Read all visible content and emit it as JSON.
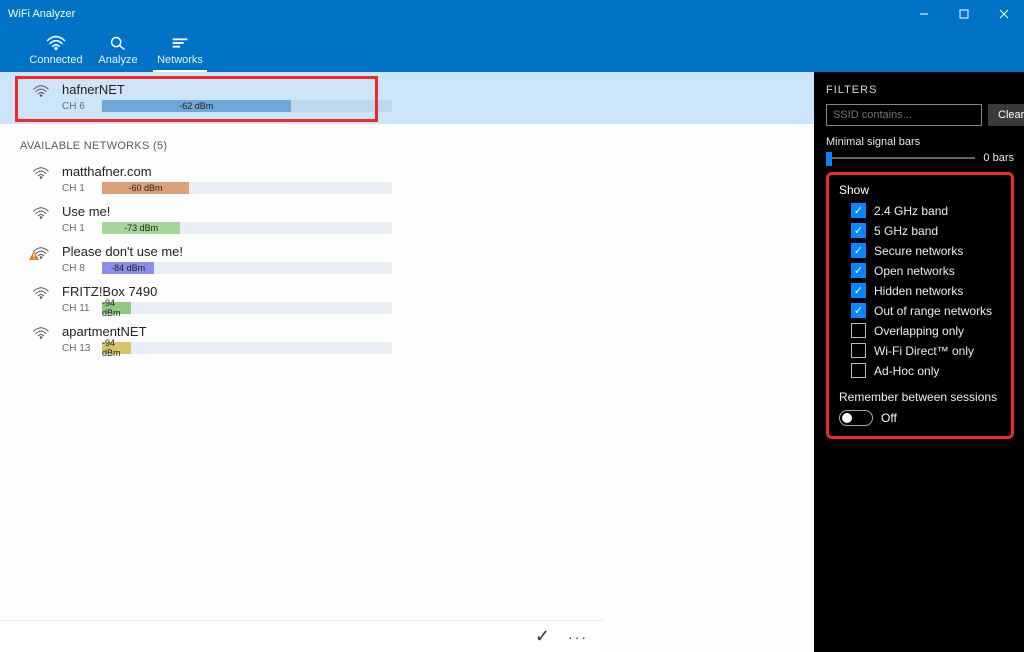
{
  "app_title": "WiFi Analyzer",
  "nav": {
    "connected": "Connected",
    "analyze": "Analyze",
    "networks": "Networks"
  },
  "connected_network": {
    "ssid": "hafnerNET",
    "channel": "CH 6",
    "signal_label": "-62 dBm",
    "bar_pct": 65,
    "bar_color": "#6ea7d9"
  },
  "available_header": "AVAILABLE NETWORKS (5)",
  "networks": [
    {
      "ssid": "matthafner.com",
      "channel": "CH 1",
      "signal_label": "-60 dBm",
      "bar_pct": 30,
      "bar_color": "#d9a27a",
      "warn": false
    },
    {
      "ssid": "Use me!",
      "channel": "CH 1",
      "signal_label": "-73 dBm",
      "bar_pct": 27,
      "bar_color": "#a6d69a",
      "warn": false
    },
    {
      "ssid": "Please don't use me!",
      "channel": "CH 8",
      "signal_label": "-84 dBm",
      "bar_pct": 18,
      "bar_color": "#8b8fea",
      "warn": true
    },
    {
      "ssid": "FRITZ!Box 7490",
      "channel": "CH 11",
      "signal_label": "-94 dBm",
      "bar_pct": 10,
      "bar_color": "#8fc97f",
      "warn": false
    },
    {
      "ssid": "apartmentNET",
      "channel": "CH 13",
      "signal_label": "-94 dBm",
      "bar_pct": 10,
      "bar_color": "#d6c46a",
      "warn": false
    }
  ],
  "filters": {
    "title": "FILTERS",
    "ssid_placeholder": "SSID contains...",
    "clear": "Clear",
    "min_signal_label": "Minimal signal bars",
    "bars_value": "0 bars",
    "show": "Show",
    "options": [
      {
        "label": "2.4 GHz band",
        "checked": true
      },
      {
        "label": "5 GHz band",
        "checked": true
      },
      {
        "label": "Secure networks",
        "checked": true
      },
      {
        "label": "Open networks",
        "checked": true
      },
      {
        "label": "Hidden networks",
        "checked": true
      },
      {
        "label": "Out of range networks",
        "checked": true
      },
      {
        "label": "Overlapping only",
        "checked": false
      },
      {
        "label": "Wi-Fi Direct™ only",
        "checked": false
      },
      {
        "label": "Ad-Hoc only",
        "checked": false
      }
    ],
    "remember": "Remember between sessions",
    "toggle_state": "Off"
  },
  "colors": {
    "accent": "#0173c7",
    "highlight": "#f02828",
    "check": "#0a84ff"
  }
}
